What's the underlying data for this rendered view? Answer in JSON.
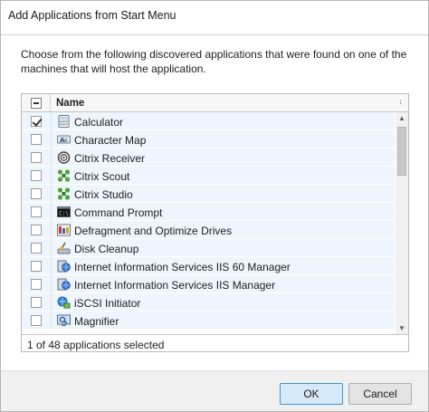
{
  "dialog": {
    "title": "Add Applications from Start Menu",
    "description": "Choose from the following discovered applications that were found on one of the machines that will host the application."
  },
  "grid": {
    "column_name": "Name",
    "rows": [
      {
        "label": "Calculator",
        "checked": true,
        "icon": "calculator-icon"
      },
      {
        "label": "Character Map",
        "checked": false,
        "icon": "character-map-icon"
      },
      {
        "label": "Citrix Receiver",
        "checked": false,
        "icon": "citrix-receiver-icon"
      },
      {
        "label": "Citrix Scout",
        "checked": false,
        "icon": "citrix-scout-icon"
      },
      {
        "label": "Citrix Studio",
        "checked": false,
        "icon": "citrix-studio-icon"
      },
      {
        "label": "Command Prompt",
        "checked": false,
        "icon": "command-prompt-icon"
      },
      {
        "label": "Defragment and Optimize Drives",
        "checked": false,
        "icon": "defragment-icon"
      },
      {
        "label": "Disk Cleanup",
        "checked": false,
        "icon": "disk-cleanup-icon"
      },
      {
        "label": "Internet Information Services IIS 60 Manager",
        "checked": false,
        "icon": "iis-icon"
      },
      {
        "label": "Internet Information Services IIS Manager",
        "checked": false,
        "icon": "iis-icon"
      },
      {
        "label": "iSCSI Initiator",
        "checked": false,
        "icon": "iscsi-icon"
      },
      {
        "label": "Magnifier",
        "checked": false,
        "icon": "magnifier-icon"
      }
    ],
    "status": "1 of 48 applications selected"
  },
  "buttons": {
    "ok": "OK",
    "cancel": "Cancel"
  }
}
